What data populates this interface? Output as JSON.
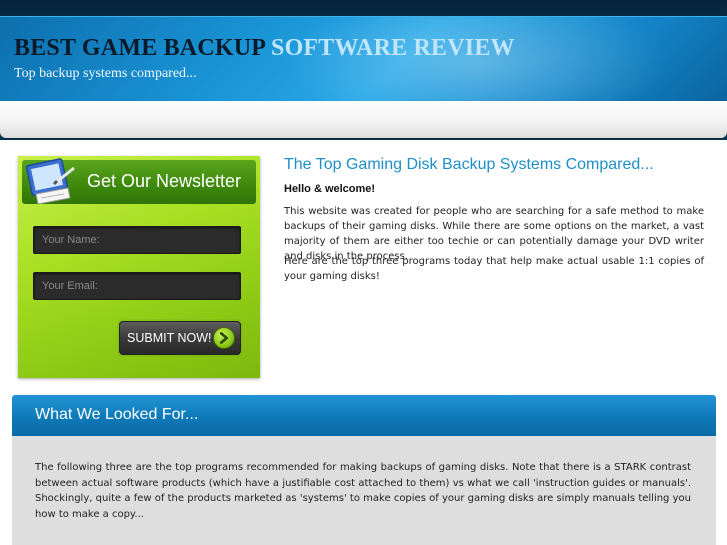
{
  "header": {
    "title_part1": "BEST GAME BACKUP",
    "title_part2": "SOFTWARE REVIEW",
    "tagline": "Top backup systems compared..."
  },
  "newsletter": {
    "title": "Get Our Newsletter",
    "icon": "newsletter-icon",
    "name_placeholder": "Your Name:",
    "email_placeholder": "Your Email:",
    "submit_label": "SUBMIT NOW!",
    "colors": {
      "box": "#a6df22",
      "header": "#3f8a0d"
    }
  },
  "intro": {
    "title": "The Top Gaming Disk Backup Systems Compared...",
    "greeting": "Hello & welcome!",
    "paragraph1": "This website was created for people who are searching for a safe method to make backups of their gaming disks. While there are some options on the market, a vast majority of them are either too techie or can potentially damage your DVD writer and disks in the process.",
    "paragraph2": "Here are the top three programs today that help make actual usable 1:1 copies of your gaming disks!"
  },
  "looked_for": {
    "title": "What We Looked For...",
    "paragraph": "The following three are the top programs recommended for making backups of gaming disks. Note that there is a STARK contrast between actual software products (which have a justifiable cost attached to them) vs what we call 'instruction guides or manuals'. Shockingly, quite a few of the products marketed as 'systems' to make copies of your gaming disks are simply manuals telling you how to make a copy..."
  },
  "colors": {
    "accent": "#1f8fc8",
    "header_blue": "#1a95d6",
    "section_blue": "#0e79b8"
  }
}
